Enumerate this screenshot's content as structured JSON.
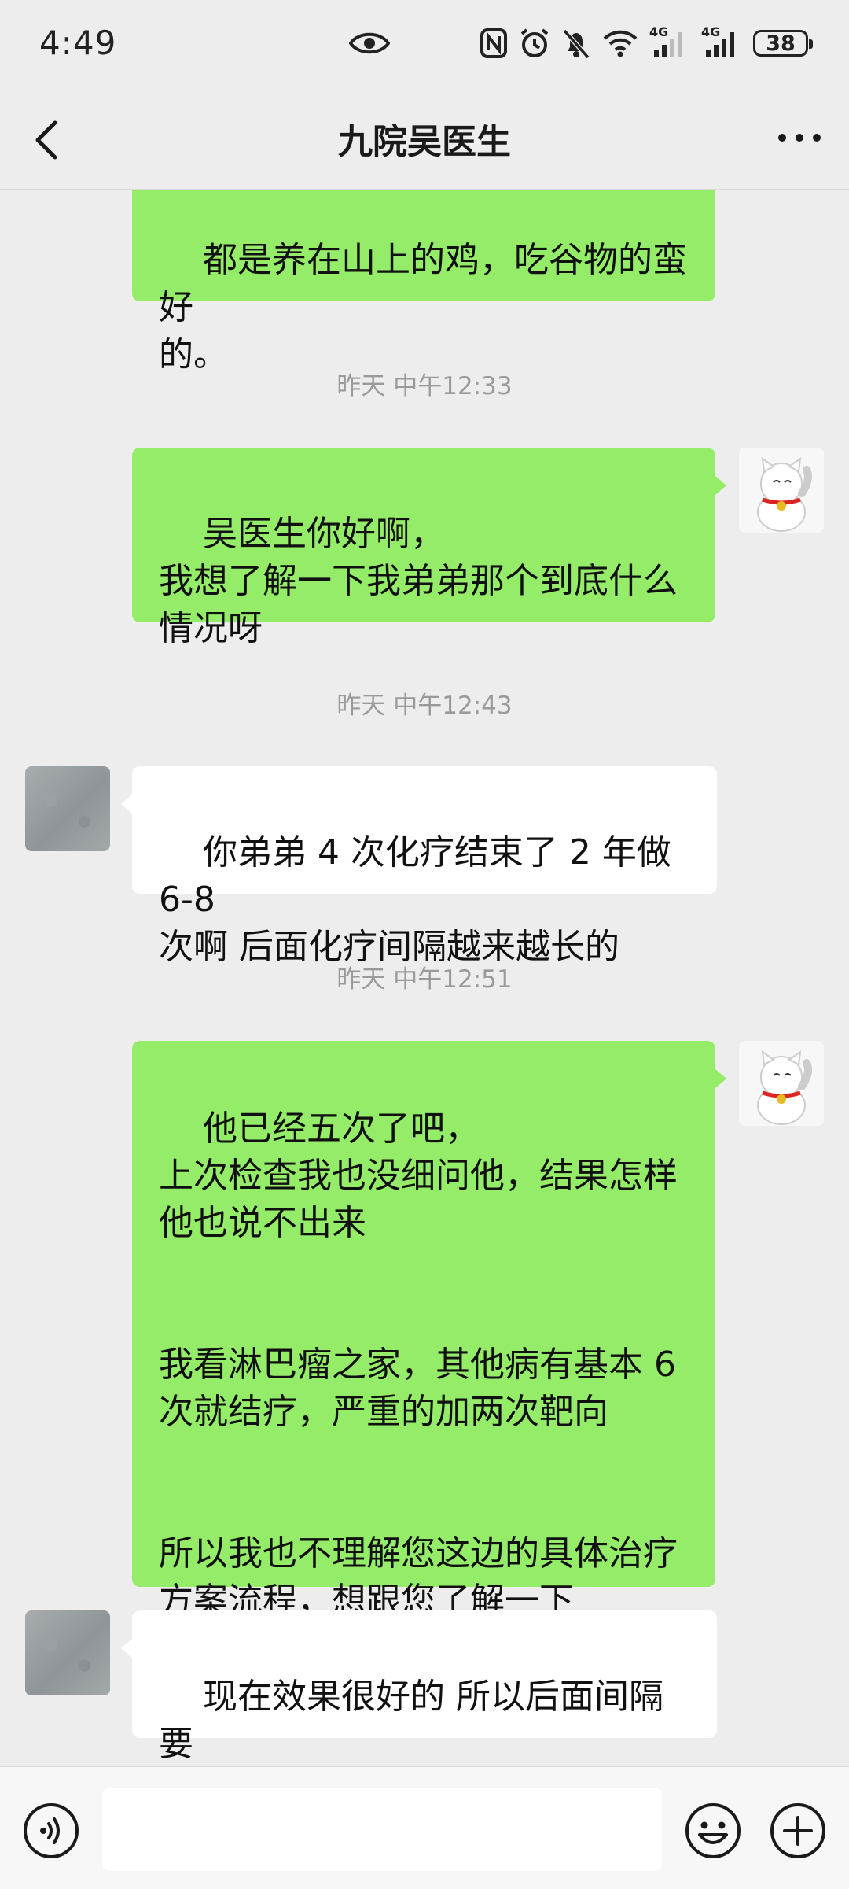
{
  "status_bar": {
    "time": "4:49",
    "network_label_1": "4G",
    "network_label_2": "4G",
    "battery": "38"
  },
  "header": {
    "title": "九院吴医生"
  },
  "messages": [
    {
      "type": "sent",
      "text": "都是养在山上的鸡，吃谷物的蛮好\n的。"
    },
    {
      "type": "time",
      "text": "昨天 中午12:33"
    },
    {
      "type": "sent",
      "text": "吴医生你好啊，\n我想了解一下我弟弟那个到底什么\n情况呀"
    },
    {
      "type": "time",
      "text": "昨天 中午12:43"
    },
    {
      "type": "received",
      "text": "你弟弟 4 次化疗结束了 2 年做 6-8\n次啊 后面化疗间隔越来越长的"
    },
    {
      "type": "time",
      "text": "昨天 中午12:51"
    },
    {
      "type": "sent",
      "text": "他已经五次了吧，\n上次检查我也没细问他，结果怎样\n他也说不出来\n\n\n我看淋巴瘤之家，其他病有基本 6\n次就结疗，严重的加两次靶向\n\n\n所以我也不理解您这边的具体治疗\n方案流程，想跟您了解一下"
    },
    {
      "type": "received",
      "text": "现在效果很好的 所以后面间隔要\n拉长"
    }
  ],
  "input": {
    "value": "",
    "placeholder": ""
  },
  "colors": {
    "sent_bubble": "#95ec69",
    "received_bubble": "#ffffff",
    "background": "#ededed"
  }
}
